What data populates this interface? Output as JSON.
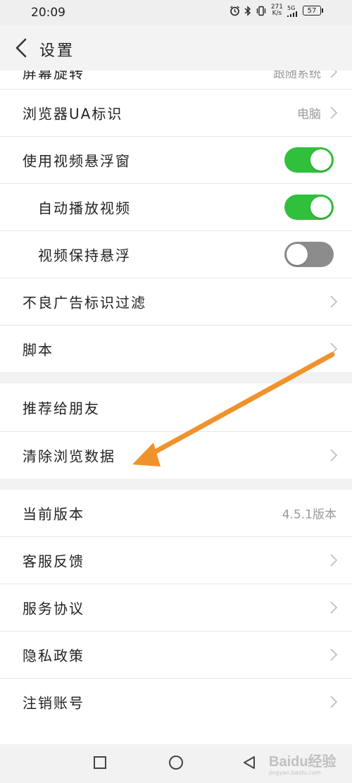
{
  "status": {
    "time": "20:09",
    "speed_value": "271",
    "speed_unit": "K/s",
    "network": "5G",
    "battery": "57"
  },
  "header": {
    "title": "设置"
  },
  "partial_row": {
    "label": "屏幕旋转",
    "value": "跟随系统"
  },
  "rows": {
    "ua": {
      "label": "浏览器UA标识",
      "value": "电脑"
    },
    "video_float": {
      "label": "使用视频悬浮窗",
      "toggle": "on"
    },
    "autoplay": {
      "label": "自动播放视频",
      "toggle": "on"
    },
    "keep_float": {
      "label": "视频保持悬浮",
      "toggle": "off"
    },
    "ad_filter": {
      "label": "不良广告标识过滤"
    },
    "script": {
      "label": "脚本"
    },
    "recommend": {
      "label": "推荐给朋友"
    },
    "clear_data": {
      "label": "清除浏览数据"
    },
    "version": {
      "label": "当前版本",
      "value": "4.5.1版本"
    },
    "feedback": {
      "label": "客服反馈"
    },
    "service": {
      "label": "服务协议"
    },
    "privacy": {
      "label": "隐私政策"
    },
    "logout": {
      "label": "注销账号"
    }
  },
  "watermark": {
    "text": "Baidu经验",
    "sub": "jingyan.baidu.com"
  },
  "colors": {
    "toggle_on": "#31c03c",
    "toggle_off": "#8c8c8c",
    "arrow": "#f0922b"
  }
}
